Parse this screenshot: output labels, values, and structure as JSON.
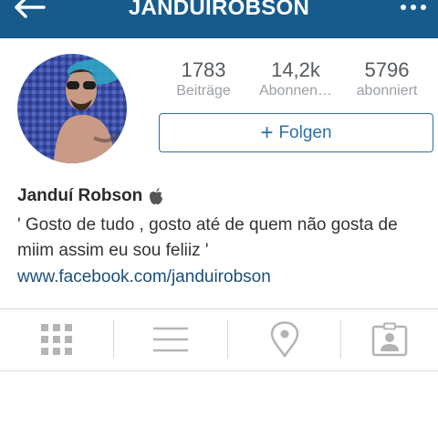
{
  "header": {
    "username": "JANDUIROBSON",
    "back_icon": "back-arrow-icon",
    "more_icon": "more-dots-icon",
    "background": "#175b8d"
  },
  "profile": {
    "stats": [
      {
        "count": "1783",
        "label": "Beiträge"
      },
      {
        "count": "14,2k",
        "label": "Abonnen…"
      },
      {
        "count": "5796",
        "label": "abonniert"
      }
    ],
    "follow_label": "Folgen",
    "full_name": "Janduí Robson",
    "name_badge_icon": "apple-icon",
    "bio": "' Gosto de tudo , gosto até de quem não gosta de miim assim eu sou feliiz '",
    "website": "www.facebook.com/janduirobson",
    "accent_color": "#2d6fa6"
  },
  "tabs": [
    {
      "icon": "grid-icon"
    },
    {
      "icon": "list-icon"
    },
    {
      "icon": "location-pin-icon"
    },
    {
      "icon": "tagged-photos-icon"
    }
  ]
}
